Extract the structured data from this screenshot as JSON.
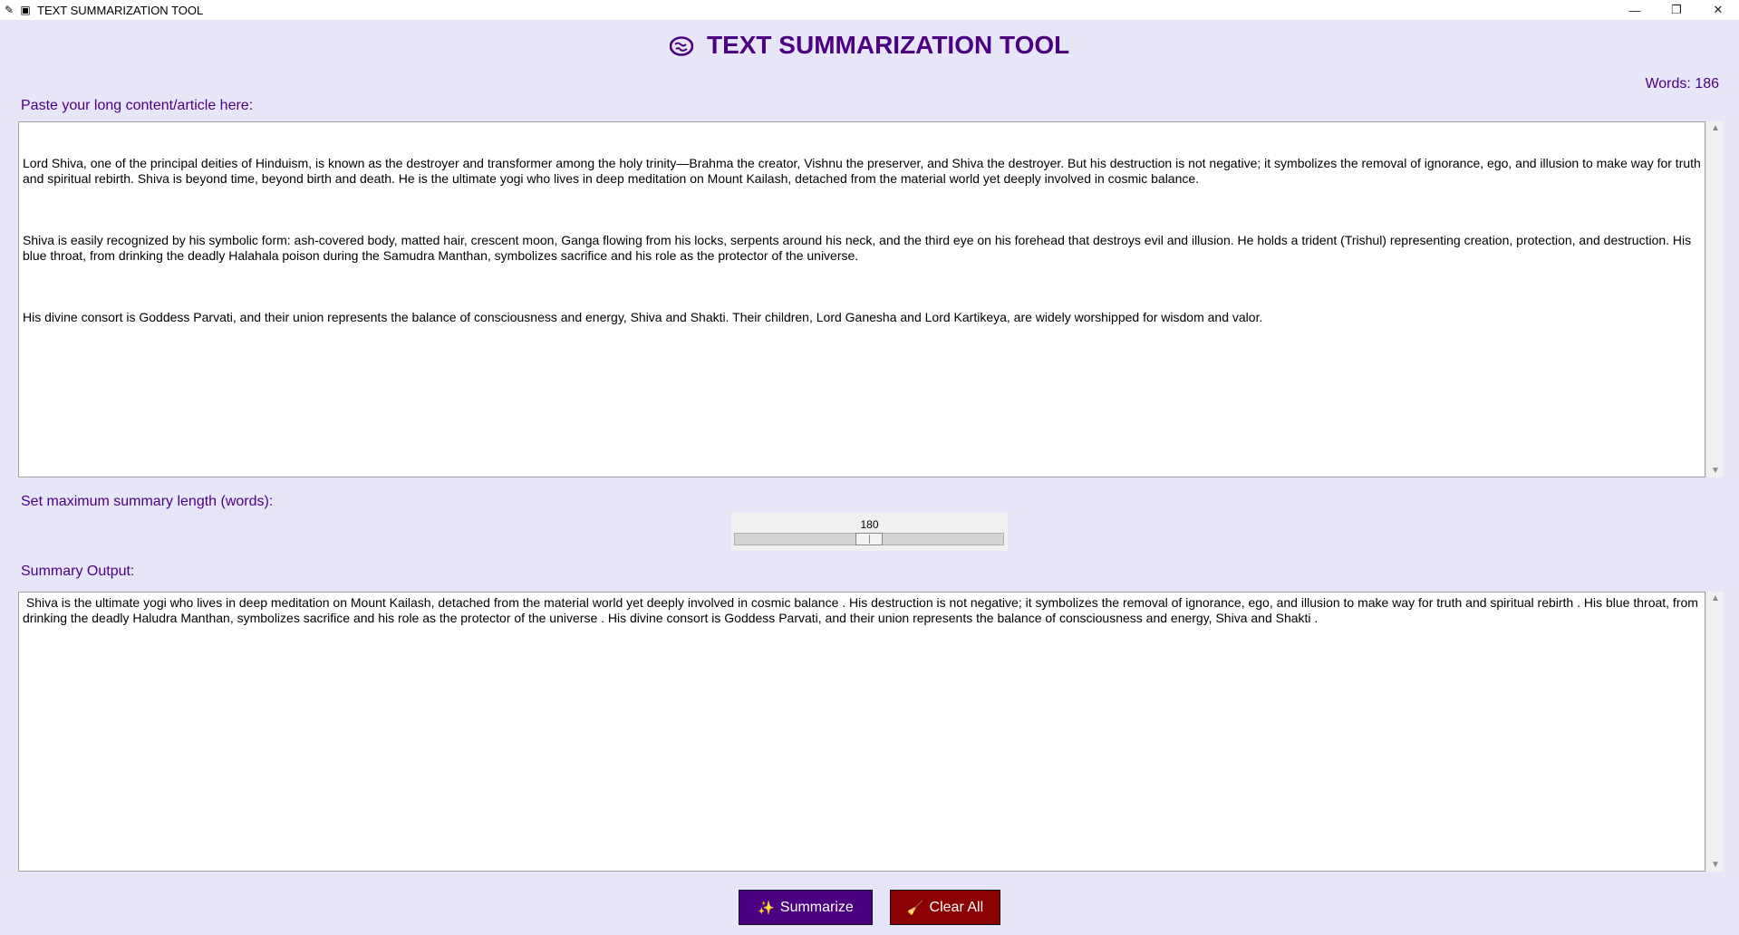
{
  "window": {
    "title": "TEXT SUMMARIZATION TOOL",
    "minimize_icon": "minimize-icon",
    "maximize_icon": "restore-icon",
    "close_icon": "close-icon"
  },
  "header": {
    "title": "TEXT SUMMARIZATION TOOL",
    "icon": "brain-icon",
    "word_count": "Words: 186"
  },
  "input": {
    "label": "Paste your long content/article here:",
    "paragraphs": [
      "Lord Shiva, one of the principal deities of Hinduism, is known as the destroyer and transformer among the holy trinity—Brahma the creator, Vishnu the preserver, and Shiva the destroyer. But his destruction is not negative; it symbolizes the removal of ignorance, ego, and illusion to make way for truth and spiritual rebirth. Shiva is beyond time, beyond birth and death. He is the ultimate yogi who lives in deep meditation on Mount Kailash, detached from the material world yet deeply involved in cosmic balance.",
      "Shiva is easily recognized by his symbolic form: ash-covered body, matted hair, crescent moon, Ganga flowing from his locks, serpents around his neck, and the third eye on his forehead that destroys evil and illusion. He holds a trident (Trishul) representing creation, protection, and destruction. His blue throat, from drinking the deadly Halahala poison during the Samudra Manthan, symbolizes sacrifice and his role as the protector of the universe.",
      "His divine consort is Goddess Parvati, and their union represents the balance of consciousness and energy, Shiva and Shakti. Their children, Lord Ganesha and Lord Kartikeya, are widely worshipped for wisdom and valor."
    ]
  },
  "slider": {
    "label": "Set maximum summary length (words):",
    "value": "180",
    "fraction": 0.5
  },
  "output": {
    "label": "Summary Output:",
    "text": " Shiva is the ultimate yogi who lives in deep meditation on Mount Kailash, detached from the material world yet deeply involved in cosmic balance . His destruction is not negative; it symbolizes the removal of ignorance, ego, and illusion to make way for truth and spiritual rebirth . His blue throat, from drinking the deadly Haludra Manthan, symbolizes sacrifice and his role as the protector of the universe . His divine consort is Goddess Parvati, and their union represents the balance of consciousness and energy, Shiva and Shakti ."
  },
  "buttons": {
    "summarize_label": "Summarize",
    "summarize_icon": "sparkles-icon",
    "summarize_color": "#4b0082",
    "clear_label": "Clear All",
    "clear_icon": "broom-icon",
    "clear_color": "#8b0000"
  }
}
